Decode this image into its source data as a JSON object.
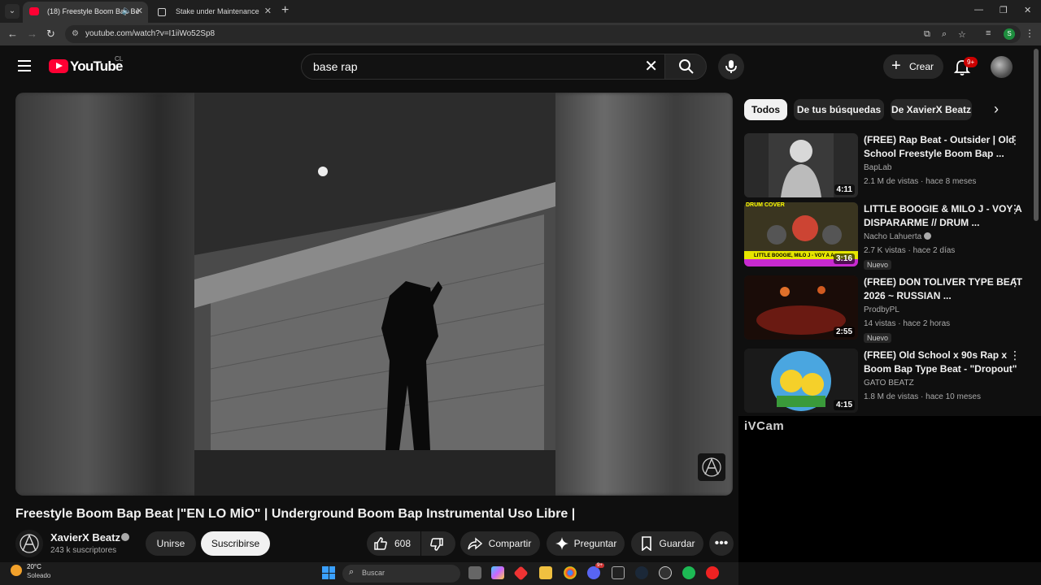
{
  "browser": {
    "tabs": [
      {
        "title": "(18) Freestyle Boom Bap Be",
        "active": true
      },
      {
        "title": "Stake under Maintenance",
        "active": false
      }
    ],
    "url": "youtube.com/watch?v=I1iiWo52Sp8"
  },
  "youtube": {
    "logo": "YouTube",
    "country": "CL",
    "search_query": "base rap",
    "create_label": "Crear",
    "notifications": "9+"
  },
  "video": {
    "title": "Freestyle Boom Bap Beat |\"EN LO MÍO\" | Underground Boom Bap Instrumental Uso Libre |",
    "channel": "XavierX Beatz",
    "subscribers": "243 k suscriptores",
    "join": "Unirse",
    "subscribe": "Suscribirse",
    "likes": "608",
    "share": "Compartir",
    "ask": "Preguntar",
    "save": "Guardar"
  },
  "sidebar": {
    "chips": [
      "Todos",
      "De tus búsquedas",
      "De XavierX Beatz"
    ],
    "recommendations": [
      {
        "title": "(FREE) Rap Beat - Outsider | Old School Freestyle Boom Bap ...",
        "channel": "BapLab",
        "meta": "2.1 M de vistas · hace 8 meses",
        "duration": "4:11",
        "badge": "",
        "verified": false
      },
      {
        "title": "LITTLE BOOGIE & MILO J - VOY A DISPARARME // DRUM ...",
        "channel": "Nacho Lahuerta",
        "meta": "2.7 K vistas · hace 2 días",
        "duration": "3:16",
        "badge": "Nuevo",
        "verified": true,
        "thumb_text": "DRUM COVER",
        "thumb_caption": "LITTLE BOOGIE, MILO J - VOY A A"
      },
      {
        "title": "(FREE) DON TOLIVER TYPE BEAT 2026 ~ RUSSIAN ...",
        "channel": "ProdbyPL",
        "meta": "14 vistas · hace 2 horas",
        "duration": "2:55",
        "badge": "Nuevo",
        "verified": false
      },
      {
        "title": "(FREE) Old School x 90s Rap x Boom Bap Type Beat - \"Dropout\"",
        "channel": "GATO BEATZ",
        "meta": "1.8 M de vistas · hace 10 meses",
        "duration": "4:15",
        "badge": "",
        "verified": false
      }
    ],
    "overlay_text": "iVCam"
  },
  "taskbar": {
    "temperature": "20°C",
    "condition": "Soleado",
    "search_placeholder": "Buscar",
    "badge": "9+"
  },
  "icons": [
    "menu-icon",
    "search-icon",
    "mic-icon",
    "bell-icon",
    "like-icon",
    "dislike-icon",
    "share-icon",
    "sparkle-icon",
    "bookmark-icon",
    "more-icon"
  ],
  "colors": {
    "brand": "#ff0033",
    "background": "#0f0f0f",
    "chip": "#272727"
  }
}
